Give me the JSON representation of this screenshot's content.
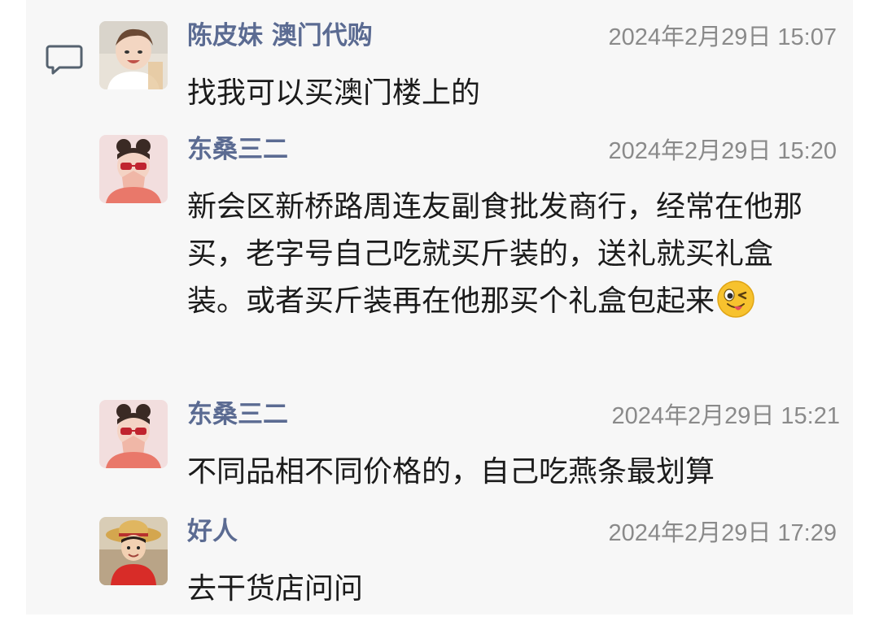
{
  "comments": [
    {
      "name": "陈皮妹 澳门代购",
      "time": "2024年2月29日 15:07",
      "text": "找我可以买澳门楼上的",
      "avatar": "baby-portrait"
    },
    {
      "name": "东桑三二",
      "time": "2024年2月29日 15:20",
      "text": "新会区新桥路周连友副食批发商行，经常在他那买，老字号自己吃就买斤装的，送礼就买礼盒装。或者买斤装再在他那买个礼盒包起来",
      "emoji": "winking-tongue-emoji",
      "avatar": "girl-with-glasses-portrait"
    },
    {
      "name": "东桑三二",
      "time": "2024年2月29日 15:21",
      "text": "不同品相不同价格的，自己吃燕条最划算",
      "avatar": "girl-with-glasses-portrait"
    },
    {
      "name": "好人",
      "time": "2024年2月29日 17:29",
      "text": "去干货店问问",
      "avatar": "straw-hat-boy-portrait"
    }
  ],
  "icons": {
    "comment": "comment-bubble-icon"
  },
  "colors": {
    "name": "#5b6b92",
    "time": "#8a8a8a",
    "text": "#1b1b1b",
    "background": "#f7f7f7"
  }
}
